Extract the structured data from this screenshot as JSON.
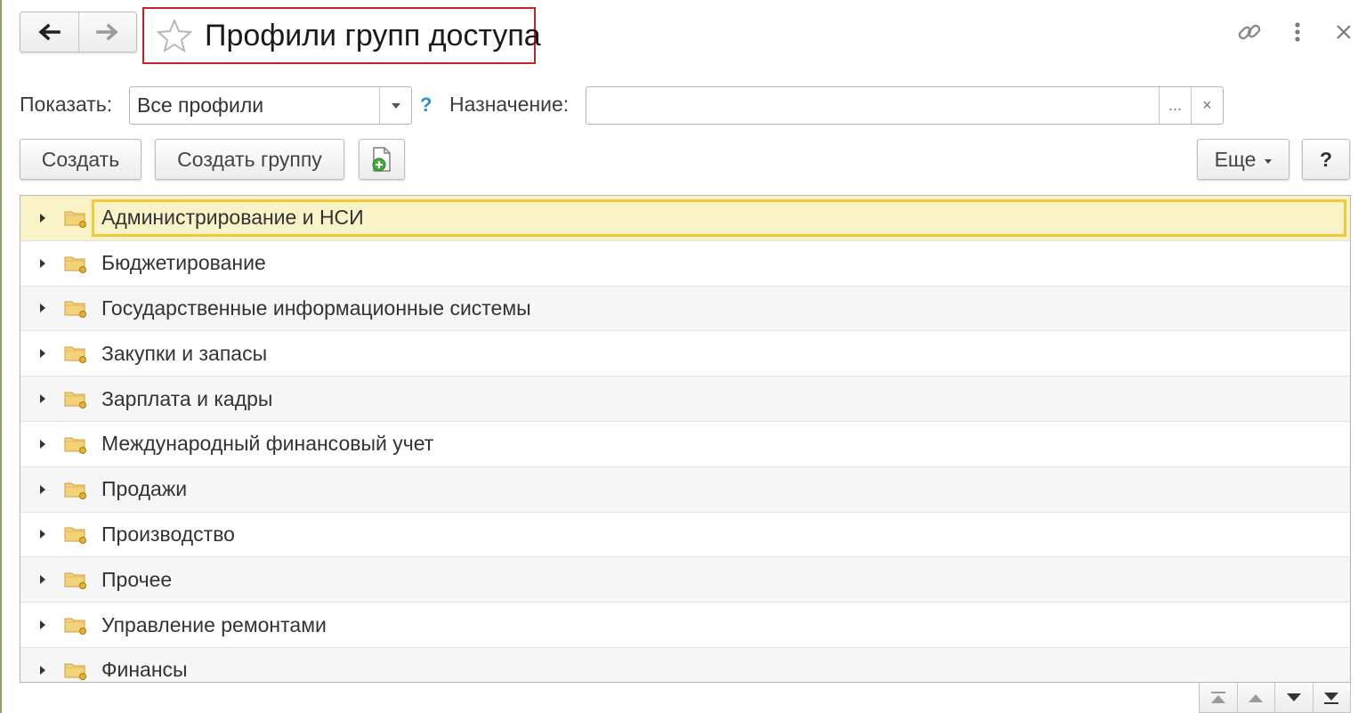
{
  "header": {
    "title": "Профили групп доступа",
    "icons": [
      "back-arrow-icon",
      "forward-arrow-icon",
      "star-icon",
      "link-icon",
      "more-vertical-icon",
      "close-icon"
    ]
  },
  "filter": {
    "show_label": "Показать:",
    "show_value": "Все профили",
    "help_symbol": "?",
    "purpose_label": "Назначение:",
    "purpose_value": "",
    "select_symbol": "...",
    "clear_symbol": "×"
  },
  "toolbar": {
    "create_label": "Создать",
    "create_group_label": "Создать группу",
    "more_label": "Еще",
    "help_label": "?"
  },
  "tree": {
    "rows": [
      {
        "label": "Администрирование и НСИ",
        "selected": true
      },
      {
        "label": "Бюджетирование"
      },
      {
        "label": "Государственные информационные системы"
      },
      {
        "label": "Закупки и запасы"
      },
      {
        "label": "Зарплата и кадры"
      },
      {
        "label": "Международный финансовый учет"
      },
      {
        "label": "Продажи"
      },
      {
        "label": "Производство"
      },
      {
        "label": "Прочее"
      },
      {
        "label": "Управление ремонтами"
      },
      {
        "label": "Финансы"
      }
    ]
  },
  "colors": {
    "title_frame": "#c8212a",
    "selection_fill": "#fbf3c8",
    "selection_border": "#f0ca3a",
    "folder": "#f3d27a",
    "accent_help": "#2f8fcf"
  }
}
